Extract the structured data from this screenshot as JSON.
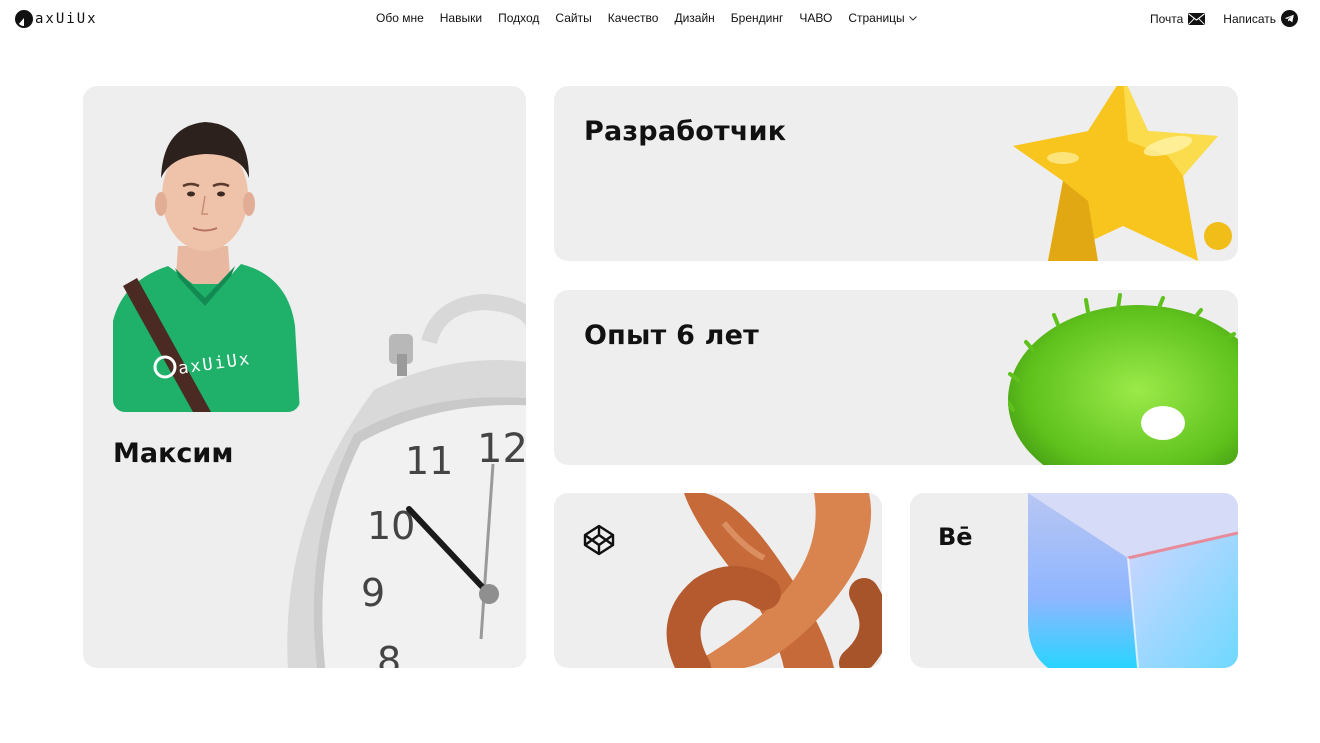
{
  "header": {
    "logo_text": "axUiUx",
    "nav": [
      {
        "label": "Обо мне"
      },
      {
        "label": "Навыки"
      },
      {
        "label": "Подход"
      },
      {
        "label": "Сайты"
      },
      {
        "label": "Качество"
      },
      {
        "label": "Дизайн"
      },
      {
        "label": "Брендинг"
      },
      {
        "label": "ЧАВО"
      },
      {
        "label": "Страницы"
      }
    ],
    "contacts": {
      "mail_label": "Почта",
      "mail_icon": "envelope-icon",
      "write_label": "Написать",
      "write_icon": "telegram-icon"
    }
  },
  "profile": {
    "name": "Максим",
    "shirt_logo": "axUiUx",
    "clock_numbers": [
      "12",
      "11",
      "10",
      "9",
      "8"
    ]
  },
  "cards": {
    "developer": {
      "title": "Разработчик",
      "icon": "star-icon"
    },
    "experience": {
      "title": "Опыт 6 лет",
      "icon": "fur-ring-icon"
    },
    "codepen": {
      "icon": "codepen-icon"
    },
    "behance": {
      "label": "Bē",
      "icon": "glass-cube-icon"
    }
  },
  "colors": {
    "card_bg": "#eeeeee",
    "text": "#111111",
    "shirt": "#1fb06a",
    "star": "#f7c51e",
    "fur": "#6ccf2e",
    "wood": "#c66a3a",
    "glass": "#8fd3ff"
  }
}
